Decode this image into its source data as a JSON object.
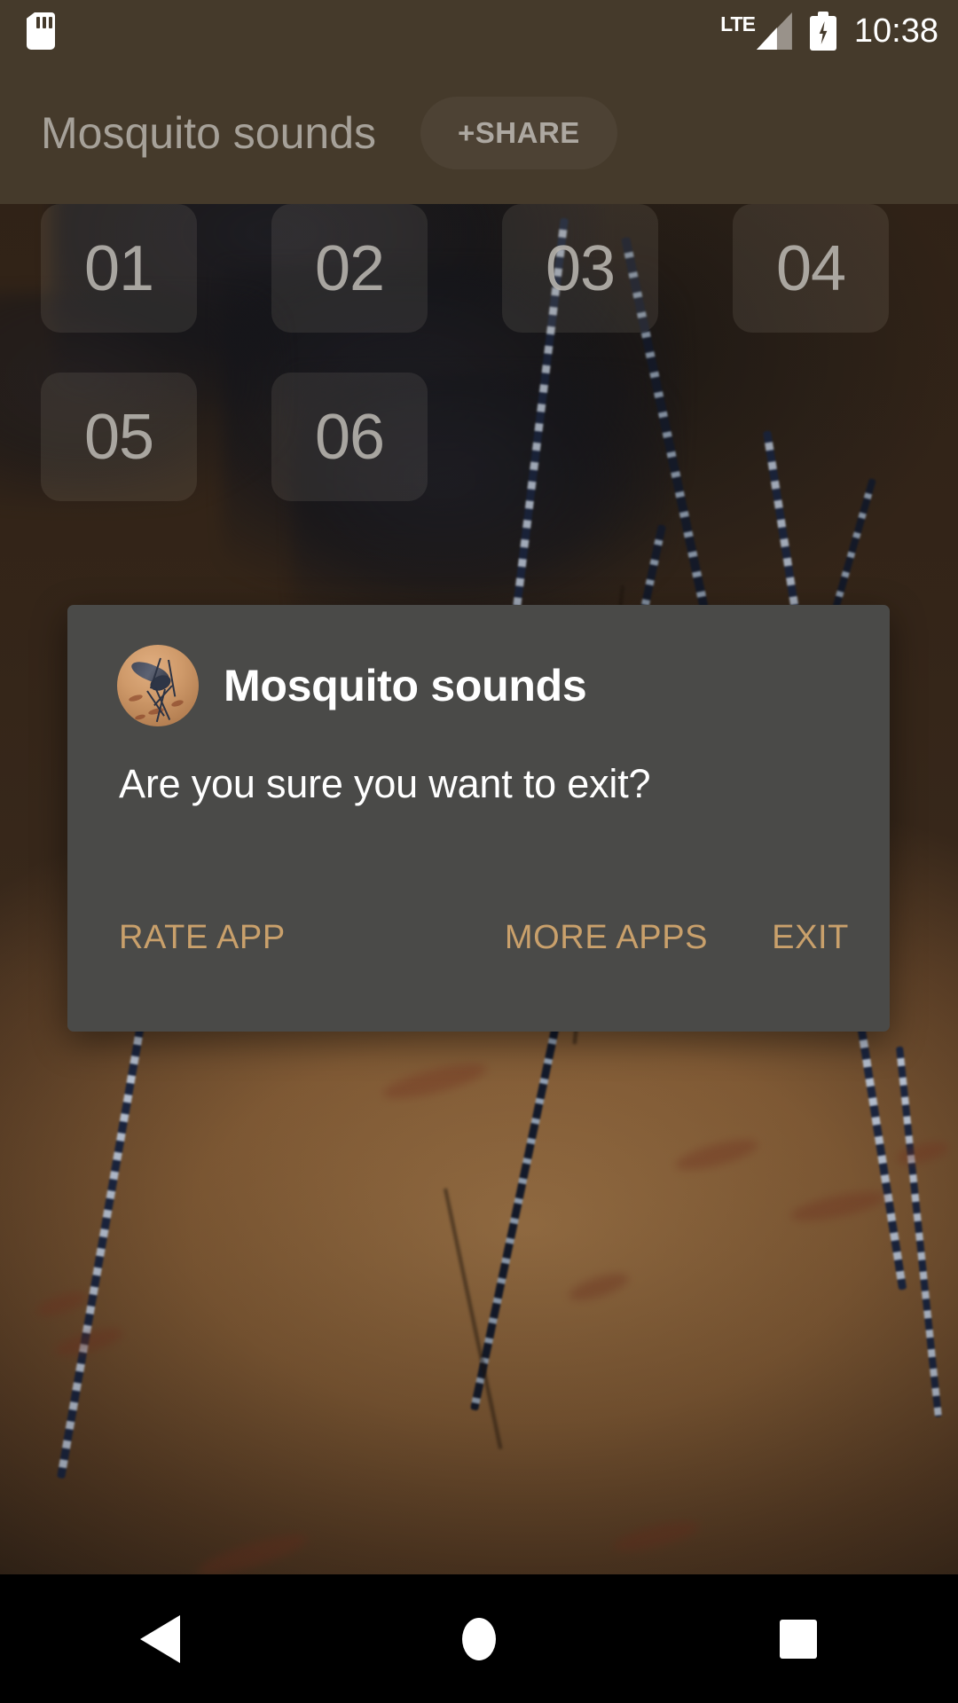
{
  "status_bar": {
    "sd_card_icon": "sd-card-icon",
    "network_type": "LTE",
    "signal_icon": "signal-bars-icon",
    "battery_icon": "battery-charging-icon",
    "clock": "10:38",
    "background_color": "#453a2b"
  },
  "app_bar": {
    "title": "Mosquito sounds",
    "share_label": "+SHARE",
    "background_color": "#453a2b"
  },
  "grid": {
    "tiles": [
      {
        "label": "01"
      },
      {
        "label": "02"
      },
      {
        "label": "03"
      },
      {
        "label": "04"
      },
      {
        "label": "05"
      },
      {
        "label": "06"
      }
    ]
  },
  "dialog": {
    "app_icon": "mosquito-app-icon",
    "title": "Mosquito sounds",
    "message": "Are you sure you want to exit?",
    "background_color": "#4a4a48",
    "accent_color": "#c9a06b",
    "buttons": {
      "rate": "RATE APP",
      "more": "MORE APPS",
      "exit": "EXIT"
    }
  },
  "nav_bar": {
    "back_icon": "back-triangle-icon",
    "home_icon": "home-circle-icon",
    "recents_icon": "recents-square-icon"
  }
}
